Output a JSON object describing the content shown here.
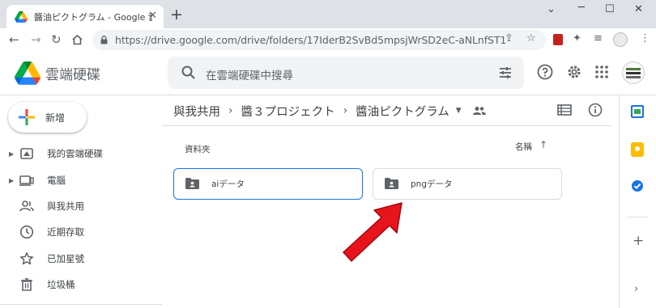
{
  "browser": {
    "tab_title": "醬油ピクトグラム - Google 雲端硬碟",
    "new_tab": "+",
    "address": "https://drive.google.com/drive/folders/17IderB2SvBd5mpsjWrSD2eC-aNLnfST1"
  },
  "drive": {
    "app_name": "雲端硬碟",
    "search_placeholder": "在雲端硬碟中搜尋"
  },
  "sidebar": {
    "new_label": "新增",
    "items": [
      {
        "label": "我的雲端硬碟",
        "icon": "my-drive-icon"
      },
      {
        "label": "電腦",
        "icon": "computer-icon"
      },
      {
        "label": "與我共用",
        "icon": "shared-icon"
      },
      {
        "label": "近期存取",
        "icon": "clock-icon"
      },
      {
        "label": "已加星號",
        "icon": "star-icon"
      },
      {
        "label": "垃圾桶",
        "icon": "trash-icon"
      }
    ]
  },
  "breadcrumb": {
    "items": [
      "與我共用",
      "醬３プロジェクト",
      "醬油ピクトグラム"
    ],
    "separator": "›"
  },
  "main": {
    "section_label": "資料夾",
    "sort_label": "名稱",
    "sort_arrow": "↑",
    "folders": [
      {
        "name": "aiデータ",
        "selected": true
      },
      {
        "name": "pngデータ",
        "selected": false
      }
    ]
  },
  "colors": {
    "accent": "#1a73e8",
    "arrow": "#e8141b",
    "selected_border": "#1a73e8",
    "folder_icon": "#5f6368"
  }
}
